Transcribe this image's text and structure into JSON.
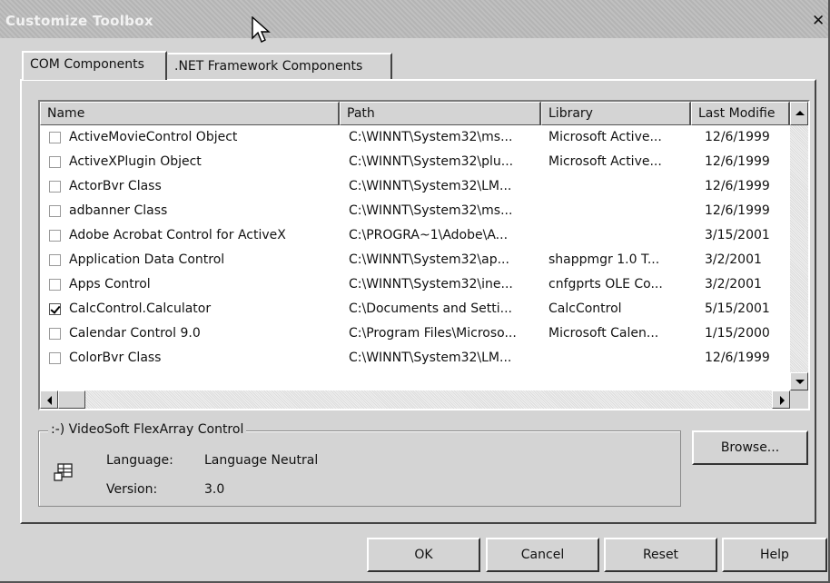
{
  "window": {
    "title": "Customize Toolbox",
    "close_glyph": "✕"
  },
  "tabs": [
    {
      "label": "COM Components",
      "active": true
    },
    {
      "label": ".NET Framework Components",
      "active": false
    }
  ],
  "list": {
    "columns": [
      "Name",
      "Path",
      "Library",
      "Last Modifie"
    ],
    "rows": [
      {
        "name": "ActiveMovieControl Object",
        "path": "C:\\WINNT\\System32\\ms...",
        "library": "Microsoft Active...",
        "modified": "12/6/1999",
        "checked": false
      },
      {
        "name": "ActiveXPlugin Object",
        "path": "C:\\WINNT\\System32\\plu...",
        "library": "Microsoft Active...",
        "modified": "12/6/1999",
        "checked": false
      },
      {
        "name": "ActorBvr Class",
        "path": "C:\\WINNT\\System32\\LM...",
        "library": "",
        "modified": "12/6/1999",
        "checked": false
      },
      {
        "name": "adbanner Class",
        "path": "C:\\WINNT\\System32\\ms...",
        "library": "",
        "modified": "12/6/1999",
        "checked": false
      },
      {
        "name": "Adobe Acrobat Control for ActiveX",
        "path": "C:\\PROGRA~1\\Adobe\\A...",
        "library": "",
        "modified": "3/15/2001",
        "checked": false
      },
      {
        "name": "Application Data Control",
        "path": "C:\\WINNT\\System32\\ap...",
        "library": "shappmgr 1.0 T...",
        "modified": "3/2/2001",
        "checked": false
      },
      {
        "name": "Apps Control",
        "path": "C:\\WINNT\\System32\\ine...",
        "library": "cnfgprts OLE Co...",
        "modified": "3/2/2001",
        "checked": false
      },
      {
        "name": "CalcControl.Calculator",
        "path": "C:\\Documents and Setti...",
        "library": "CalcControl",
        "modified": "5/15/2001",
        "checked": true
      },
      {
        "name": "Calendar Control 9.0",
        "path": "C:\\Program Files\\Microso...",
        "library": "Microsoft Calen...",
        "modified": "1/15/2000",
        "checked": false
      },
      {
        "name": "ColorBvr Class",
        "path": "C:\\WINNT\\System32\\LM...",
        "library": "",
        "modified": "12/6/1999",
        "checked": false
      }
    ]
  },
  "details": {
    "group_title": ":-) VideoSoft FlexArray Control",
    "language_label": "Language:",
    "language_value": "Language Neutral",
    "version_label": "Version:",
    "version_value": "3.0"
  },
  "buttons": {
    "browse": "Browse...",
    "ok": "OK",
    "cancel": "Cancel",
    "reset": "Reset",
    "help": "Help"
  },
  "icons": {
    "cursor": "arrow-cursor-icon",
    "component": "component-grid-icon"
  }
}
